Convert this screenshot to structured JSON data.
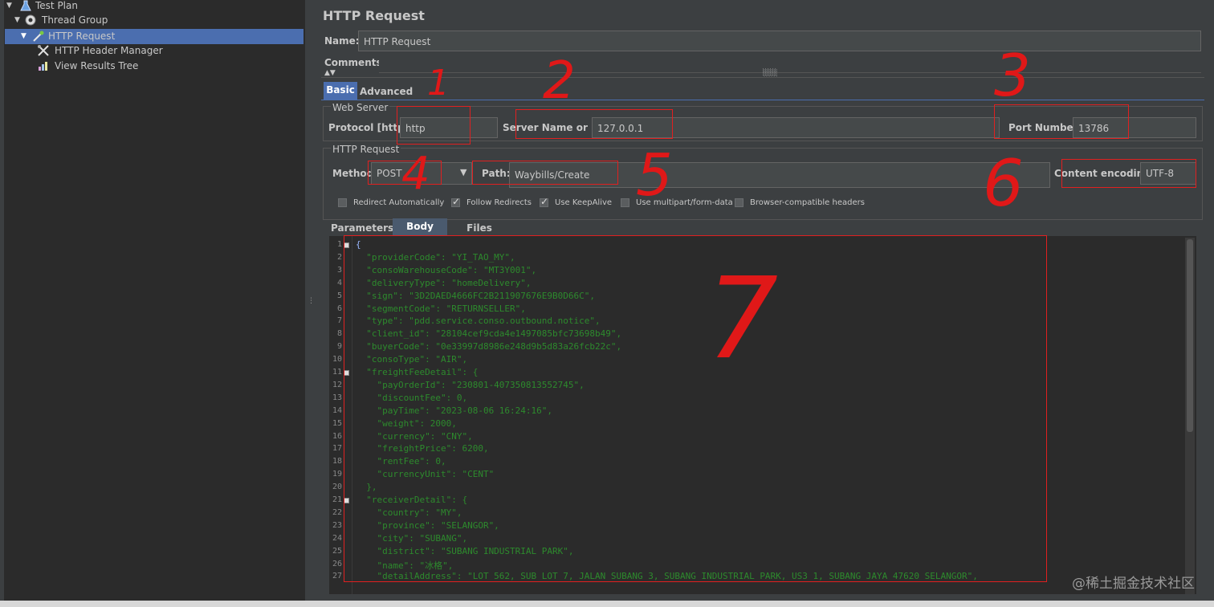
{
  "tree": {
    "nodes": [
      {
        "label": "Test Plan",
        "icon": "flask-icon"
      },
      {
        "label": "Thread Group",
        "icon": "gear-icon"
      },
      {
        "label": "HTTP Request",
        "icon": "pipette-icon",
        "selected": true
      },
      {
        "label": "HTTP Header Manager",
        "icon": "wrench-icon"
      },
      {
        "label": "View Results Tree",
        "icon": "chart-icon"
      }
    ]
  },
  "header": {
    "title": "HTTP Request",
    "name_label": "Name:",
    "name_value": "HTTP Request",
    "comments_label": "Comments:"
  },
  "tabs": {
    "basic": "Basic",
    "advanced": "Advanced"
  },
  "web_server": {
    "section_label": "Web Server",
    "protocol_label": "Protocol [http]:",
    "protocol_value": "http",
    "server_label": "Server Name or IP:",
    "server_value": "127.0.0.1",
    "port_label": "Port Number:",
    "port_value": "13786"
  },
  "http_request": {
    "section_label": "HTTP Request",
    "method_label": "Method:",
    "method_value": "POST",
    "path_label": "Path:",
    "path_value": "Waybills/Create",
    "encoding_label": "Content encoding:",
    "encoding_value": "UTF-8"
  },
  "options": [
    {
      "label": "Redirect Automatically",
      "checked": false
    },
    {
      "label": "Follow Redirects",
      "checked": true
    },
    {
      "label": "Use KeepAlive",
      "checked": true
    },
    {
      "label": "Use multipart/form-data",
      "checked": false
    },
    {
      "label": "Browser-compatible headers",
      "checked": false
    }
  ],
  "body_tabs": {
    "parameters": "Parameters",
    "body_data": "Body Data",
    "files_upload": "Files Upload"
  },
  "code_lines": [
    "{",
    "  \"providerCode\": \"YI_TAO_MY\",",
    "  \"consoWarehouseCode\": \"MT3Y001\",",
    "  \"deliveryType\": \"homeDelivery\",",
    "  \"sign\": \"3D2DAED4666FC2B211907676E9B0D66C\",",
    "  \"segmentCode\": \"RETURNSELLER\",",
    "  \"type\": \"pdd.service.conso.outbound.notice\",",
    "  \"client_id\": \"28104cef9cda4e1497085bfc73698b49\",",
    "  \"buyerCode\": \"0e33997d8986e248d9b5d83a26fcb22c\",",
    "  \"consoType\": \"AIR\",",
    "  \"freightFeeDetail\": {",
    "    \"payOrderId\": \"230801-407350813552745\",",
    "    \"discountFee\": 0,",
    "    \"payTime\": \"2023-08-06 16:24:16\",",
    "    \"weight\": 2000,",
    "    \"currency\": \"CNY\",",
    "    \"freightPrice\": 6200,",
    "    \"rentFee\": 0,",
    "    \"currencyUnit\": \"CENT\"",
    "  },",
    "  \"receiverDetail\": {",
    "    \"country\": \"MY\",",
    "    \"province\": \"SELANGOR\",",
    "    \"city\": \"SUBANG\",",
    "    \"district\": \"SUBANG INDUSTRIAL PARK\",",
    "    \"name\": \"冰格\",",
    "    \"detailAddress\": \"LOT 562, SUB LOT 7, JALAN SUBANG 3, SUBANG INDUSTRIAL PARK, US3 1, SUBANG JAYA 47620 SELANGOR\","
  ],
  "annotations": [
    "1",
    "2",
    "3",
    "4",
    "5",
    "6",
    "7"
  ],
  "watermark": "@稀土掘金技术社区",
  "colors": {
    "selection": "#4b6eaf",
    "annotation": "#e02020",
    "code": "#2d8a2d",
    "background": "#3c3f41"
  }
}
